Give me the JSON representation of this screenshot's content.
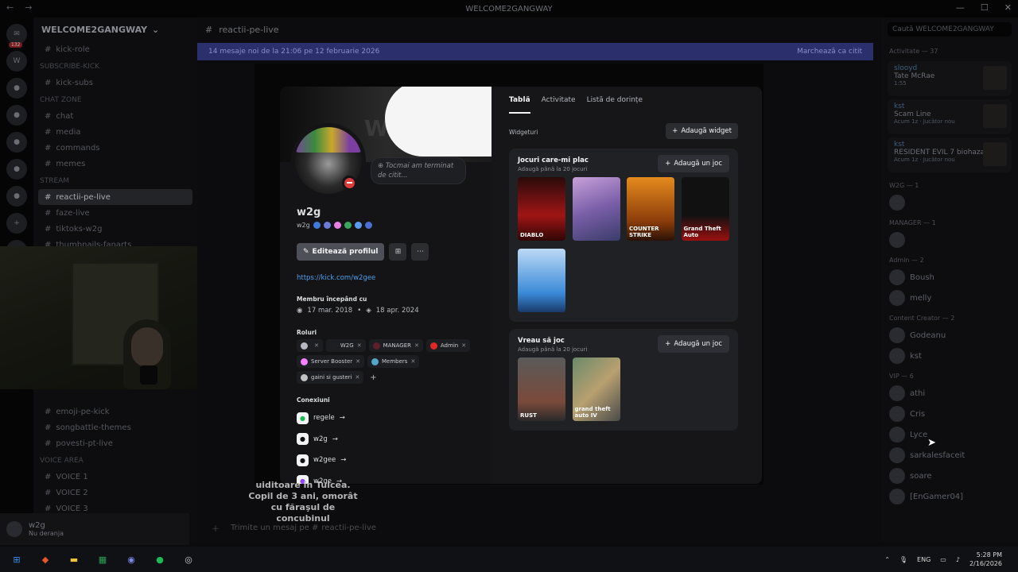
{
  "window": {
    "title": "WELCOME2GANGWAY"
  },
  "server": {
    "name": "WELCOME2GANGWAY",
    "channels": [
      {
        "name": "kick-role"
      },
      {
        "category": "SUBSCRIBE-KICK"
      },
      {
        "name": "kick-subs"
      },
      {
        "category": "CHAT ZONE"
      },
      {
        "name": "chat"
      },
      {
        "name": "media"
      },
      {
        "name": "commands"
      },
      {
        "name": "memes"
      },
      {
        "category": "STREAM"
      },
      {
        "name": "reactii-pe-live",
        "active": true
      },
      {
        "name": "faze-live"
      },
      {
        "name": "tiktoks-w2g"
      },
      {
        "name": "thumbnails-fanarts"
      }
    ],
    "lower_channels": [
      {
        "name": "emoji-pe-kick"
      },
      {
        "name": "songbattle-themes"
      },
      {
        "name": "povesti-pt-live"
      },
      {
        "category": "VOICE AREA"
      },
      {
        "name": "VOICE 1"
      },
      {
        "name": "VOICE 2"
      },
      {
        "name": "VOICE 3"
      }
    ]
  },
  "chat": {
    "channel": "reactii-pe-live",
    "new_messages": "14 mesaje noi de la 21:06 pe 12 februarie 2026",
    "mark_read": "Marchează ca citit",
    "caption": "uiditoare în Tulcea. Copil de 3 ani, omorât cu făraşul de concubinul",
    "input_placeholder": "Trimite un mesaj pe #",
    "input_channel": "reactii-pe-live"
  },
  "user_panel": {
    "name": "w2g",
    "status": "Nu deranja"
  },
  "members": {
    "search": "Caută WELCOME2GANGWAY",
    "activity_header": "Activitate — 37",
    "activities": [
      {
        "user": "slooyd",
        "title": "Tate McRae",
        "sub": "1:55"
      },
      {
        "user": "kst",
        "title": "Scam Line",
        "sub": "Acum 1z · Jucător nou"
      },
      {
        "user": "kst",
        "title": "RESIDENT EVIL 7 biohaza...",
        "sub": "Acum 1z · Jucător nou"
      }
    ],
    "groups": [
      {
        "label": "W2G — 1",
        "names": [
          ""
        ]
      },
      {
        "label": "MANAGER — 1",
        "names": [
          ""
        ]
      },
      {
        "label": "Admin — 2",
        "names": [
          "Boush",
          "melly"
        ]
      },
      {
        "label": "Content Creator — 2",
        "names": [
          "Godeanu",
          "kst"
        ]
      },
      {
        "label": "VIP — 6",
        "names": [
          "athi",
          "Cris",
          "Lyce",
          "sarkalesfaceit",
          "soare",
          "[EnGamer04]"
        ]
      }
    ]
  },
  "profile": {
    "username": "w2g",
    "handle": "w2g",
    "thought": "Tocmai am terminat de citit...",
    "edit_button": "Editează profilul",
    "link": "https://kick.com/w2gee",
    "member_since_title": "Membru începând cu",
    "discord_date": "17 mar. 2018",
    "server_date": "18 apr. 2024",
    "roles_title": "Roluri",
    "roles": [
      {
        "name": "",
        "color": "#b5b8bf"
      },
      {
        "name": "W2G",
        "color": "#1e1f23"
      },
      {
        "name": "MANAGER",
        "color": "#5c1f2b"
      },
      {
        "name": "Admin",
        "color": "#e02828"
      },
      {
        "name": "Server Booster",
        "color": "#f47fff"
      },
      {
        "name": "Members",
        "color": "#53a7c9"
      },
      {
        "name": "gaini si gusteri",
        "color": "#c2c2c2"
      }
    ],
    "connections_title": "Conexiuni",
    "connections": [
      {
        "name": "regele",
        "icon": "spotify-icon",
        "color": "#1db954"
      },
      {
        "name": "w2g",
        "icon": "steam-icon",
        "color": "#f2f3f5"
      },
      {
        "name": "w2gee",
        "icon": "tiktok-icon",
        "color": "#f2f3f5"
      },
      {
        "name": "w2ge",
        "icon": "twitch-icon",
        "color": "#9146ff"
      }
    ],
    "tabs": [
      "Tablă",
      "Activitate",
      "Listă de dorințe"
    ],
    "widgets_label": "Widgeturi",
    "add_widget": "Adaugă widget",
    "favorite_games": {
      "title": "Jocuri care-mi plac",
      "subtitle": "Adaugă până la 20 jocuri",
      "add": "Adaugă un joc",
      "games": [
        {
          "label": "DIABLO",
          "bg": "linear-gradient(180deg,#2a0a0a,#a01515 60%,#300505)"
        },
        {
          "label": "",
          "bg": "linear-gradient(160deg,#c7a0d9,#7a5fa8 50%,#3a3c6a)"
        },
        {
          "label": "COUNTER STRIKE",
          "bg": "linear-gradient(180deg,#e58a1e,#8a3c0a 70%,#2a1205)"
        },
        {
          "label": "Grand Theft Auto",
          "bg": "linear-gradient(180deg,#111,#111 60%,#9b1010)"
        },
        {
          "label": "",
          "bg": "linear-gradient(180deg,#bcd9f5,#3a8ad8 70%,#1a3a6a)"
        }
      ]
    },
    "want_to_play": {
      "title": "Vreau să joc",
      "subtitle": "Adaugă până la 20 jocuri",
      "add": "Adaugă un joc",
      "games": [
        {
          "label": "RUST",
          "bg": "linear-gradient(180deg,#5a5a5a,#7a4a3a 70%,#2a2a2a)"
        },
        {
          "label": "grand theft auto IV",
          "bg": "linear-gradient(135deg,#6a8a6a,#b8a070 50%,#4a4a4a)"
        }
      ]
    }
  },
  "taskbar": {
    "lang": "ENG",
    "time": "5:28 PM",
    "date": "2/16/2026"
  }
}
